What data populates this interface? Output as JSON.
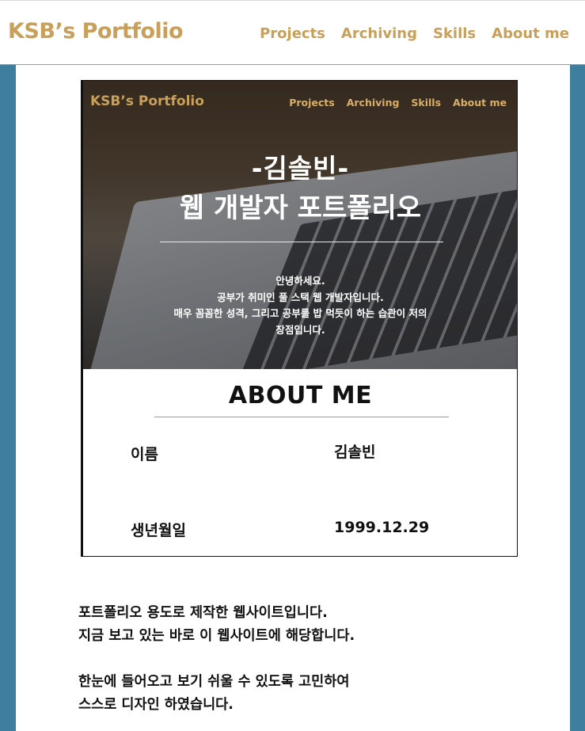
{
  "header": {
    "brand": "KSB’s Portfolio",
    "nav": [
      "Projects",
      "Archiving",
      "Skills",
      "About me"
    ]
  },
  "preview": {
    "brand": "KSB’s Portfolio",
    "nav": [
      "Projects",
      "Archiving",
      "Skills",
      "About me"
    ],
    "hero": {
      "name": "-김솔빈-",
      "title": "웹 개발자 포트폴리오",
      "intro": [
        "안녕하세요.",
        "공부가 취미인 풀 스택 웹 개발자입니다.",
        "매우 꼼꼼한 성격, 그리고 공부를 밥 먹듯이 하는 습관이 저의",
        "장점입니다."
      ]
    },
    "about": {
      "title": "ABOUT ME",
      "rows": [
        {
          "label": "이름",
          "value": "김솔빈"
        },
        {
          "label": "생년월일",
          "value": "1999.12.29"
        }
      ]
    }
  },
  "description": {
    "paragraphs": [
      [
        "포트폴리오 용도로 제작한 웹사이트입니다.",
        "지금 보고 있는 바로 이 웹사이트에 해당합니다."
      ],
      [
        "한눈에 들어오고 보기 쉬울 수 있도록 고민하여",
        "스스로 디자인 하였습니다."
      ]
    ]
  },
  "colors": {
    "accent": "#c9a05a",
    "background": "#3f7e9f",
    "panel": "#ffffff",
    "text": "#111111"
  }
}
